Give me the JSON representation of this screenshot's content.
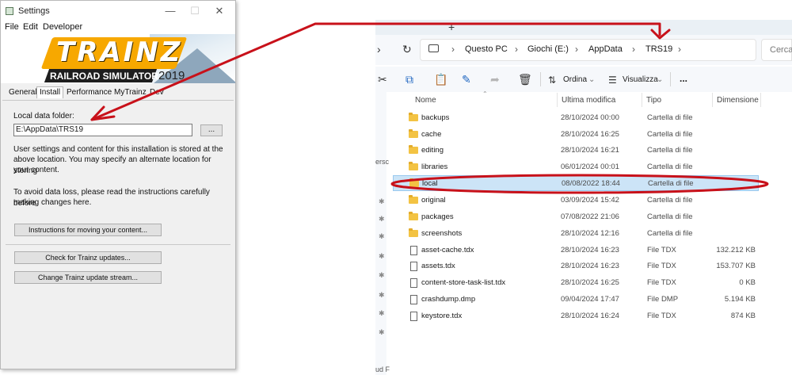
{
  "settings": {
    "title": "Settings",
    "menu": [
      "File",
      "Edit",
      "Developer"
    ],
    "logo": {
      "name": "TRAINZ",
      "subtitle": "RAILROAD SIMULATOR",
      "year": "2019"
    },
    "tabs": [
      "General",
      "Install",
      "Performance",
      "MyTrainz",
      "Dev"
    ],
    "active_tab": "Install",
    "local_data_label": "Local data folder:",
    "local_data_path": "E:\\AppData\\TRS19",
    "browse_label": "...",
    "info_lines": [
      "User settings and content for this installation is stored at the",
      "above location. You may specify an alternate location for storing",
      "your content."
    ],
    "warning_lines": [
      "To avoid data loss, please read the instructions carefully before",
      "making changes here."
    ],
    "buttons": {
      "instructions": "Instructions for moving your content...",
      "check_updates": "Check for Trainz updates...",
      "change_stream": "Change Trainz update stream..."
    }
  },
  "explorer": {
    "new_tab": "+",
    "breadcrumb": [
      "Questo PC",
      "Giochi (E:)",
      "AppData",
      "TRS19"
    ],
    "search_placeholder": "Cerca",
    "toolbar": {
      "sort": "Ordina",
      "view": "Visualizza",
      "more": "..."
    },
    "columns": [
      "Nome",
      "Ultima modifica",
      "Tipo",
      "Dimensione"
    ],
    "nav_fragments": [
      "ersc",
      "ud F"
    ],
    "rows": [
      {
        "name": "backups",
        "date": "28/10/2024 00:00",
        "type": "Cartella di file",
        "size": "",
        "kind": "folder"
      },
      {
        "name": "cache",
        "date": "28/10/2024 16:25",
        "type": "Cartella di file",
        "size": "",
        "kind": "folder"
      },
      {
        "name": "editing",
        "date": "28/10/2024 16:21",
        "type": "Cartella di file",
        "size": "",
        "kind": "folder"
      },
      {
        "name": "libraries",
        "date": "06/01/2024 00:01",
        "type": "Cartella di file",
        "size": "",
        "kind": "folder"
      },
      {
        "name": "local",
        "date": "08/08/2022 18:44",
        "type": "Cartella di file",
        "size": "",
        "kind": "folder",
        "selected": true
      },
      {
        "name": "original",
        "date": "03/09/2024 15:42",
        "type": "Cartella di file",
        "size": "",
        "kind": "folder"
      },
      {
        "name": "packages",
        "date": "07/08/2022 21:06",
        "type": "Cartella di file",
        "size": "",
        "kind": "folder"
      },
      {
        "name": "screenshots",
        "date": "28/10/2024 12:16",
        "type": "Cartella di file",
        "size": "",
        "kind": "folder"
      },
      {
        "name": "asset-cache.tdx",
        "date": "28/10/2024 16:23",
        "type": "File TDX",
        "size": "132.212 KB",
        "kind": "file"
      },
      {
        "name": "assets.tdx",
        "date": "28/10/2024 16:23",
        "type": "File TDX",
        "size": "153.707 KB",
        "kind": "file"
      },
      {
        "name": "content-store-task-list.tdx",
        "date": "28/10/2024 16:25",
        "type": "File TDX",
        "size": "0 KB",
        "kind": "file"
      },
      {
        "name": "crashdump.dmp",
        "date": "09/04/2024 17:47",
        "type": "File DMP",
        "size": "5.194 KB",
        "kind": "file"
      },
      {
        "name": "keystore.tdx",
        "date": "28/10/2024 16:24",
        "type": "File TDX",
        "size": "874 KB",
        "kind": "file"
      }
    ]
  },
  "colors": {
    "annotation_red": "#c8111a",
    "selection_bg": "#cce4f7",
    "folder_yellow": "#f3c343",
    "logo_orange": "#f7a800"
  }
}
